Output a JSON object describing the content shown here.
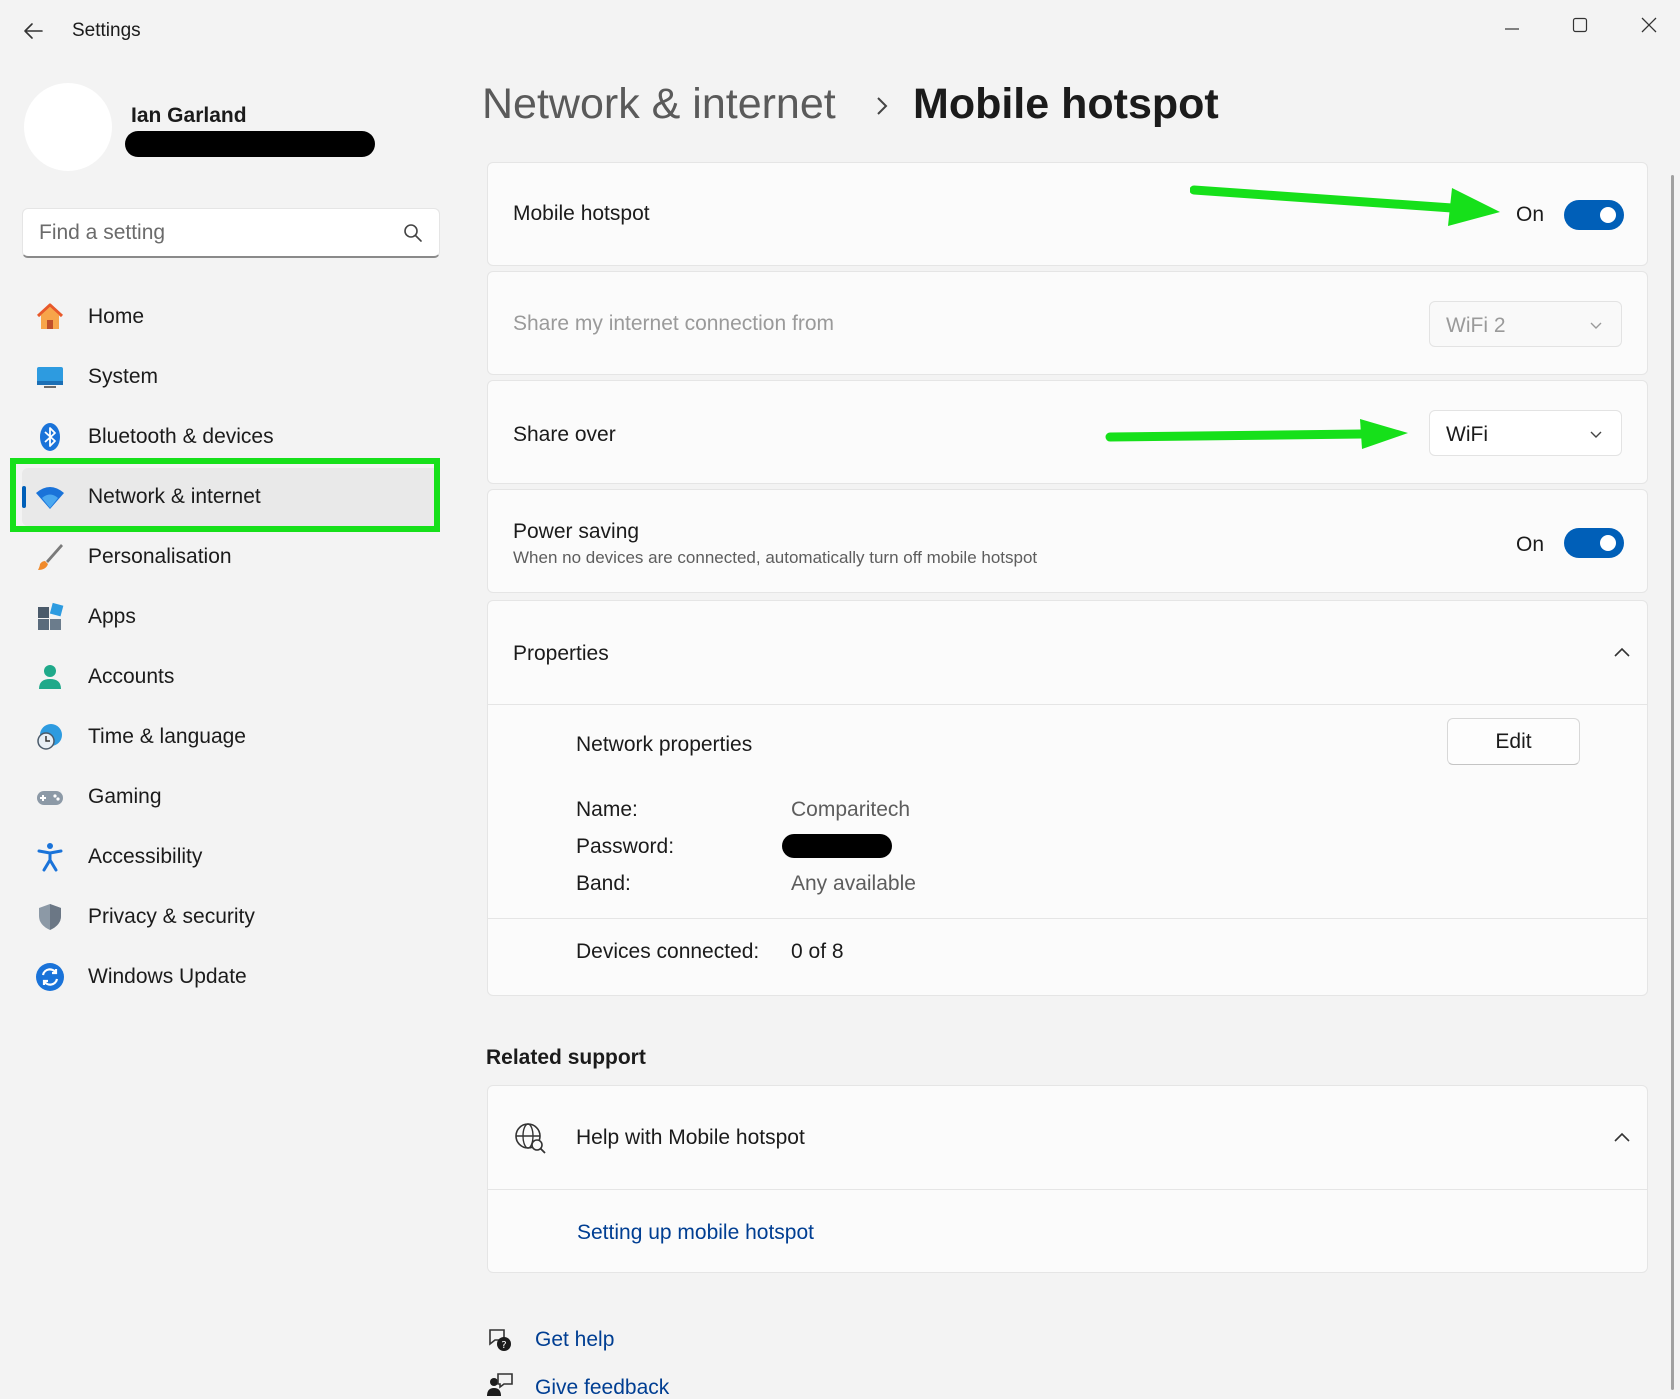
{
  "window": {
    "title": "Settings",
    "back_icon": "arrow-left-icon",
    "minimize_icon": "minimize-icon",
    "maximize_icon": "maximize-icon",
    "close_icon": "close-icon"
  },
  "profile": {
    "name": "Ian Garland"
  },
  "search": {
    "placeholder": "Find a setting",
    "value": ""
  },
  "sidebar": {
    "items": [
      {
        "label": "Home",
        "icon": "home-icon"
      },
      {
        "label": "System",
        "icon": "system-icon"
      },
      {
        "label": "Bluetooth & devices",
        "icon": "bluetooth-icon"
      },
      {
        "label": "Network & internet",
        "icon": "wifi-icon",
        "active": true
      },
      {
        "label": "Personalisation",
        "icon": "brush-icon"
      },
      {
        "label": "Apps",
        "icon": "apps-icon"
      },
      {
        "label": "Accounts",
        "icon": "person-icon"
      },
      {
        "label": "Time & language",
        "icon": "globe-clock-icon"
      },
      {
        "label": "Gaming",
        "icon": "gamepad-icon"
      },
      {
        "label": "Accessibility",
        "icon": "accessibility-icon"
      },
      {
        "label": "Privacy & security",
        "icon": "shield-icon"
      },
      {
        "label": "Windows Update",
        "icon": "update-icon"
      }
    ]
  },
  "breadcrumb": {
    "parent": "Network & internet",
    "current": "Mobile hotspot"
  },
  "hotspot": {
    "label": "Mobile hotspot",
    "state": "On"
  },
  "share_from": {
    "label": "Share my internet connection from",
    "value": "WiFi 2"
  },
  "share_over": {
    "label": "Share over",
    "value": "WiFi"
  },
  "power_saving": {
    "label": "Power saving",
    "description": "When no devices are connected, automatically turn off mobile hotspot",
    "state": "On"
  },
  "properties": {
    "title": "Properties",
    "network_properties_label": "Network properties",
    "edit_label": "Edit",
    "name_label": "Name:",
    "name_value": "Comparitech",
    "password_label": "Password:",
    "band_label": "Band:",
    "band_value": "Any available",
    "devices_label": "Devices connected:",
    "devices_value": "0 of 8"
  },
  "related_support": {
    "heading": "Related support",
    "help_title": "Help with Mobile hotspot",
    "help_icon": "globe-search-icon",
    "link": "Setting up mobile hotspot"
  },
  "footer": {
    "get_help": "Get help",
    "get_help_icon": "help-chat-icon",
    "give_feedback": "Give feedback",
    "give_feedback_icon": "feedback-icon"
  },
  "colors": {
    "accent": "#005fb8",
    "annotation_green": "#16e01a",
    "link": "#003e92"
  }
}
